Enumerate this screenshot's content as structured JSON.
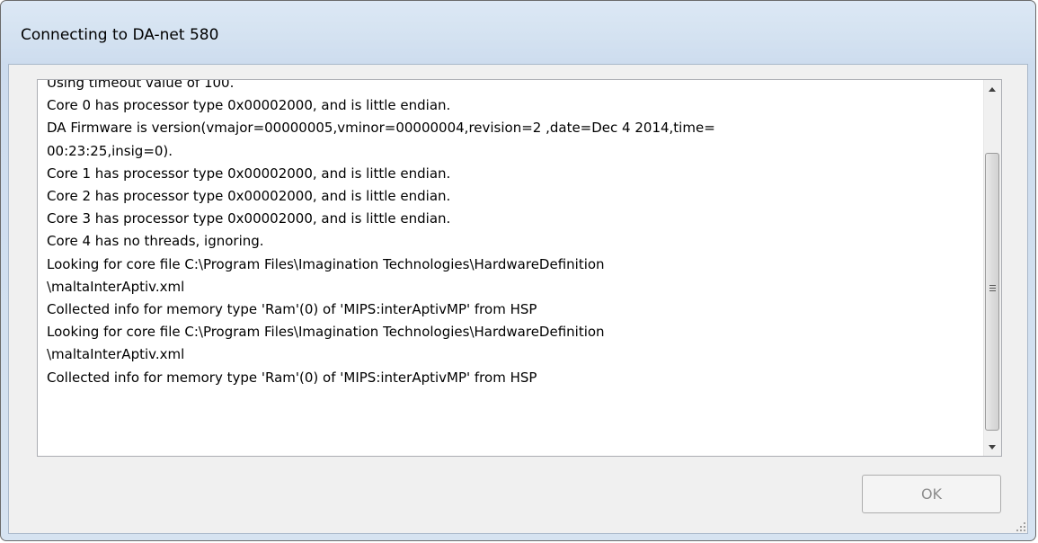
{
  "window": {
    "title": "Connecting to DA-net 580"
  },
  "log": {
    "lines": [
      "Using timeout value of 100.",
      "Core 0 has processor type 0x00002000, and is little endian.",
      "DA Firmware is version(vmajor=00000005,vminor=00000004,revision=2 ,date=Dec  4 2014,time=",
      "00:23:25,insig=0).",
      "Core 1 has processor type 0x00002000, and is little endian.",
      "Core 2 has processor type 0x00002000, and is little endian.",
      "Core 3 has processor type 0x00002000, and is little endian.",
      "Core 4 has no threads, ignoring.",
      "Looking for core file C:\\Program Files\\Imagination Technologies\\HardwareDefinition",
      "\\maltaInterAptiv.xml",
      "Collected info for memory type 'Ram'(0) of 'MIPS:interAptivMP' from HSP",
      "Looking for core file C:\\Program Files\\Imagination Technologies\\HardwareDefinition",
      "\\maltaInterAptiv.xml",
      "Collected info for memory type 'Ram'(0) of 'MIPS:interAptivMP' from HSP"
    ]
  },
  "buttons": {
    "ok_label": "OK",
    "ok_enabled": false
  },
  "icons": {
    "scroll_up": "scroll-up-arrow-icon",
    "scroll_down": "scroll-down-arrow-icon",
    "thumb_grip": "scroll-thumb-grip-icon",
    "resize": "resize-grip-icon"
  }
}
